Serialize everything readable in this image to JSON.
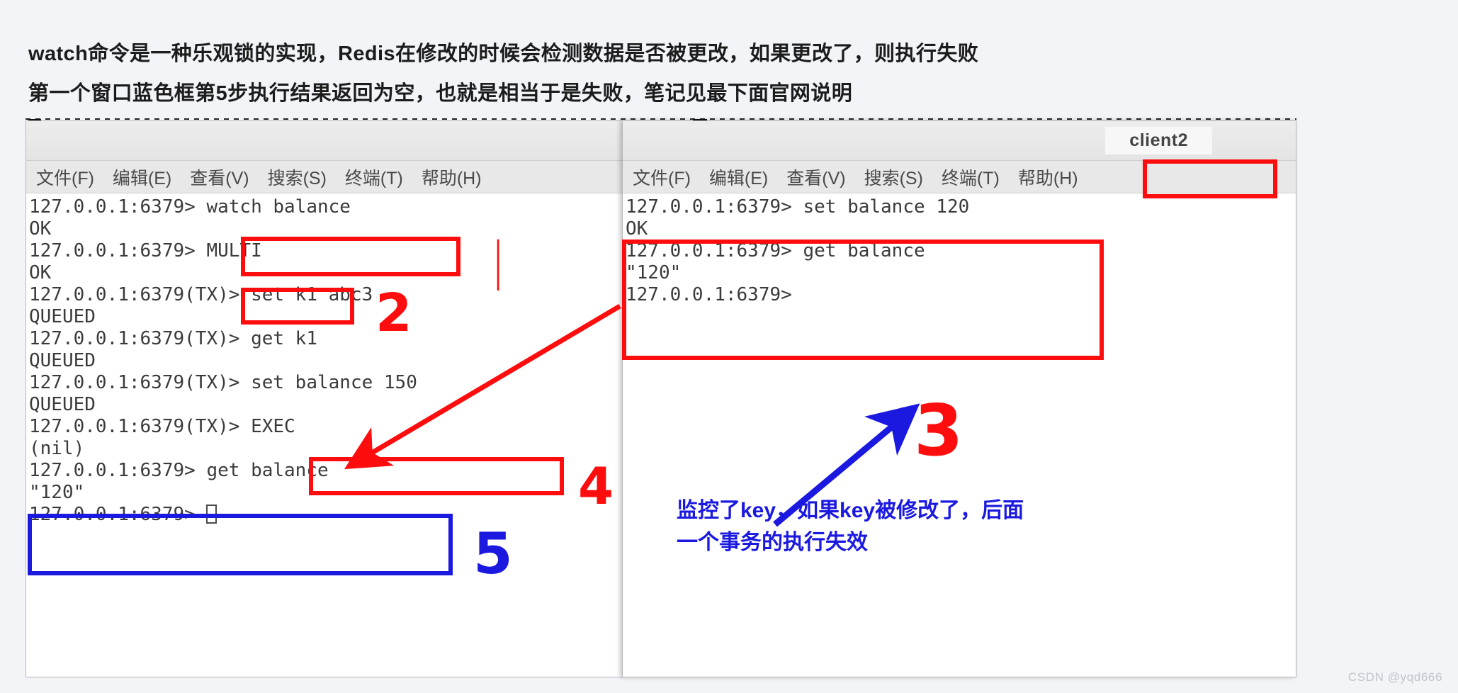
{
  "headline": {
    "line1": "watch命令是一种乐观锁的实现，Redis在修改的时候会检测数据是否被更改，如果更改了，则执行失败",
    "line2": "第一个窗口蓝色框第5步执行结果返回为空，也就是相当于是失败，笔记见最下面官网说明"
  },
  "menu": {
    "file": "文件(F)",
    "edit": "编辑(E)",
    "view": "查看(V)",
    "search": "搜索(S)",
    "terminal": "终端(T)",
    "help": "帮助(H)"
  },
  "left_window": {
    "title_tab": "",
    "lines": [
      "127.0.0.1:6379> watch balance",
      "OK",
      "127.0.0.1:6379> MULTI",
      "OK",
      "127.0.0.1:6379(TX)> set k1 abc3",
      "QUEUED",
      "127.0.0.1:6379(TX)> get k1",
      "QUEUED",
      "127.0.0.1:6379(TX)> set balance 150",
      "QUEUED",
      "127.0.0.1:6379(TX)> EXEC",
      "(nil)",
      "127.0.0.1:6379> get balance",
      "\"120\"",
      "127.0.0.1:6379> "
    ]
  },
  "right_window": {
    "title_tab": "client2",
    "lines": [
      "127.0.0.1:6379> set balance 120",
      "OK",
      "127.0.0.1:6379> get balance",
      "\"120\"",
      "127.0.0.1:6379>"
    ]
  },
  "annotations": {
    "step1": "|",
    "step2": "2",
    "step3": "3",
    "step4": "4",
    "step5": "5",
    "note_line1": "监控了key，如果key被修改了，后面",
    "note_line2": "一个事务的执行失效"
  },
  "colors": {
    "annotation_red": "#fd0d0d",
    "annotation_blue": "#1b19e0",
    "page_background": "#f2f4f8",
    "terminal_background": "#ffffff",
    "terminal_text": "#3b3b3b"
  },
  "watermark": "CSDN @yqd666"
}
